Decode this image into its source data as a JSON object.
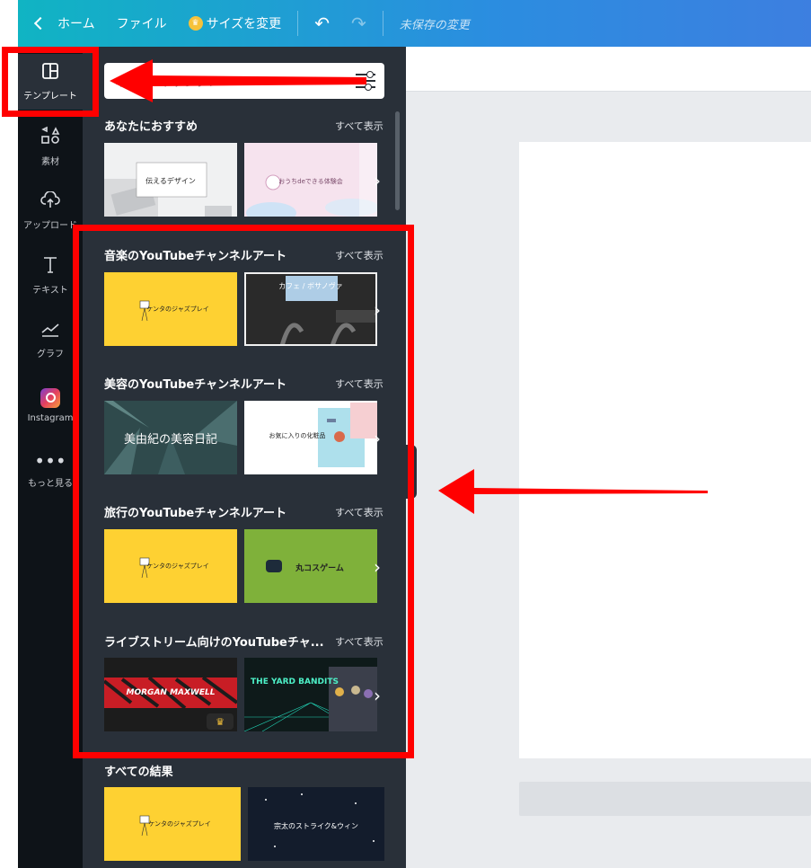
{
  "topbar": {
    "home_label": "ホーム",
    "file_label": "ファイル",
    "resize_label": "サイズを変更",
    "unsaved_label": "未保存の変更",
    "undo_icon": "undo-icon",
    "redo_icon": "redo-icon"
  },
  "sidebar": {
    "items": [
      {
        "label": "テンプレート",
        "icon": "template-icon"
      },
      {
        "label": "素材",
        "icon": "elements-icon"
      },
      {
        "label": "アップロード",
        "icon": "upload-icon"
      },
      {
        "label": "テキスト",
        "icon": "text-icon"
      },
      {
        "label": "グラフ",
        "icon": "chart-icon"
      },
      {
        "label": "Instagram",
        "icon": "instagram-icon"
      },
      {
        "label": "もっと見る",
        "icon": "more-icon"
      }
    ]
  },
  "panel": {
    "search_placeholder": "ネルアートテンプレー",
    "show_all": "すべて表示",
    "sections": [
      {
        "title": "あなたにおすすめ",
        "thumbs": [
          "伝えるデザイン",
          "おうちdeできる体験会"
        ]
      },
      {
        "title": "音楽のYouTubeチャンネルアート",
        "thumbs": [
          "ケンタのジャズプレイ",
          "カフェ / ボサノヴァ"
        ]
      },
      {
        "title": "美容のYouTubeチャンネルアート",
        "thumbs": [
          "美由紀の美容日記",
          "お気に入りの化粧品"
        ]
      },
      {
        "title": "旅行のYouTubeチャンネルアート",
        "thumbs": [
          "ケンタのジャズプレイ",
          "丸コスゲーム"
        ]
      },
      {
        "title": "ライブストリーム向けのYouTubeチャ...",
        "thumbs": [
          "MORGAN MAXWELL",
          "THE YARD BANDITS"
        ]
      },
      {
        "title": "すべての結果",
        "thumbs": [
          "ケンタのジャズプレイ",
          "宗太のストライク&ウィン"
        ]
      }
    ]
  },
  "colors": {
    "accent_red": "#ff0000",
    "panel_bg": "#293039",
    "nav_bg": "#0e1318",
    "thumb_yellow": "#fed132",
    "thumb_green": "#7fb13a"
  }
}
